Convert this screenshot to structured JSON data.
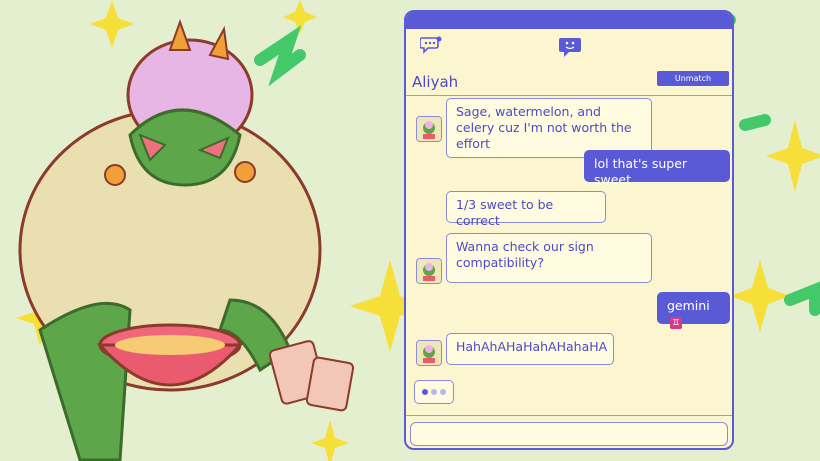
{
  "background": {
    "colors": {
      "bg": "#e4efcf",
      "accent_green": "#44c96a",
      "star": "#f6df39"
    }
  },
  "chat": {
    "contact_name": "Aliyah",
    "unmatch_label": "Unmatch",
    "icons": {
      "chat_list": "chat-bubble-dots-icon",
      "chat_face": "chat-bubble-face-icon"
    },
    "messages": [
      {
        "from": "them",
        "text": "Sage, watermelon, and celery cuz I'm not worth the effort"
      },
      {
        "from": "me",
        "text": "lol that's super sweet"
      },
      {
        "from": "them",
        "text": "1/3 sweet to be correct"
      },
      {
        "from": "them",
        "text": "Wanna check our sign compatibility?"
      },
      {
        "from": "me",
        "text": "gemini",
        "emoji": "♊"
      },
      {
        "from": "them",
        "text": "HahAhAHaHahAHahaHA"
      }
    ],
    "typing_indicator": true,
    "input_value": "",
    "colors": {
      "primary": "#5a5ad6",
      "panel": "#fbf6cf"
    }
  }
}
